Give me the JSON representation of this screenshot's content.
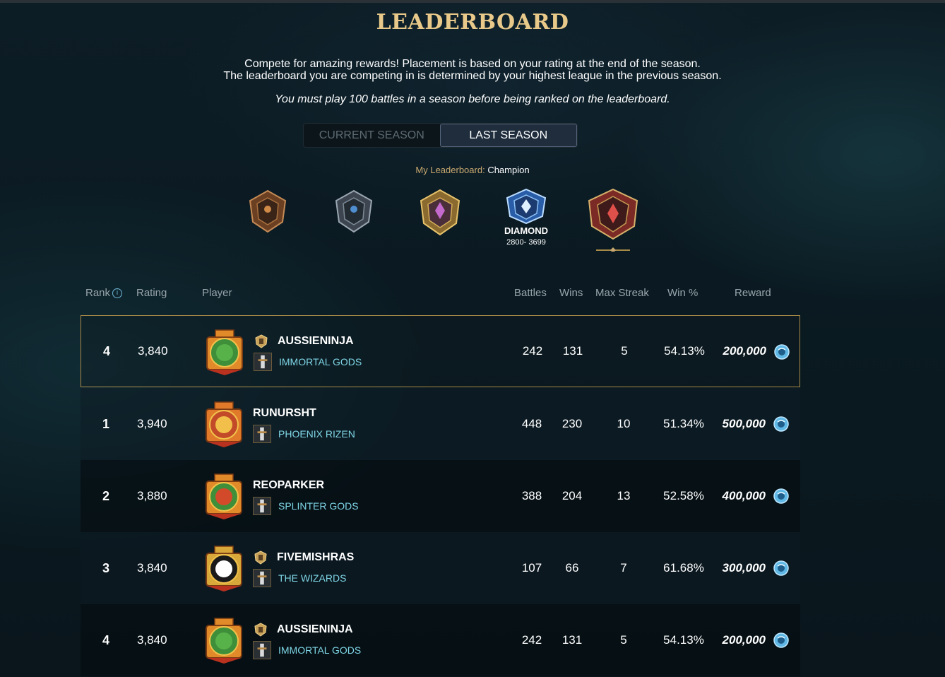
{
  "header": {
    "title": "LEADERBOARD",
    "intro_line1": "Compete for amazing rewards! Placement is based on your rating at the end of the season.",
    "intro_line2": "The leaderboard you are competing in is determined by your highest league in the previous season.",
    "note": "You must play 100 battles in a season before being ranked on the leaderboard."
  },
  "tabs": {
    "current": "CURRENT SEASON",
    "last": "LAST SEASON",
    "selected": "last"
  },
  "my_leaderboard": {
    "label": "My Leaderboard:",
    "value": "Champion"
  },
  "leagues": {
    "items": [
      {
        "icon": "bronze-league-icon",
        "name": "",
        "range": ""
      },
      {
        "icon": "silver-league-icon",
        "name": "",
        "range": ""
      },
      {
        "icon": "gold-league-icon",
        "name": "",
        "range": ""
      },
      {
        "icon": "diamond-league-icon",
        "name": "DIAMOND",
        "range": "2800- 3699"
      },
      {
        "icon": "champion-league-icon",
        "name": "",
        "range": ""
      }
    ],
    "selected_index": 4
  },
  "columns": {
    "rank": "Rank",
    "rating": "Rating",
    "player": "Player",
    "battles": "Battles",
    "wins": "Wins",
    "max_streak": "Max Streak",
    "win_pct": "Win %",
    "reward": "Reward"
  },
  "rows": [
    {
      "rank": "4",
      "rating": "3,840",
      "player": "AUSSIENINJA",
      "guild": "IMMORTAL GODS",
      "battles": "242",
      "wins": "131",
      "max_streak": "5",
      "win_pct": "54.13%",
      "reward": "200,000",
      "avatar": "orc-avatar-icon",
      "title_icon": "shield-title-icon",
      "guild_icon": "sword-guild-icon",
      "highlighted": true
    },
    {
      "rank": "1",
      "rating": "3,940",
      "player": "RUNURSHT",
      "guild": "PHOENIX RIZEN",
      "battles": "448",
      "wins": "230",
      "max_streak": "10",
      "win_pct": "51.34%",
      "reward": "500,000",
      "avatar": "fire-skull-avatar-icon",
      "title_icon": "",
      "guild_icon": "phoenix-guild-icon",
      "highlighted": false
    },
    {
      "rank": "2",
      "rating": "3,880",
      "player": "REOPARKER",
      "guild": "SPLINTER GODS",
      "battles": "388",
      "wins": "204",
      "max_streak": "13",
      "win_pct": "52.58%",
      "reward": "400,000",
      "avatar": "jester-avatar-icon",
      "title_icon": "",
      "guild_icon": "skull-guild-icon",
      "highlighted": false
    },
    {
      "rank": "3",
      "rating": "3,840",
      "player": "FIVEMISHRAS",
      "guild": "THE WIZARDS",
      "battles": "107",
      "wins": "66",
      "max_streak": "7",
      "win_pct": "61.68%",
      "reward": "300,000",
      "avatar": "monster-mouth-avatar-icon",
      "title_icon": "tower-title-icon",
      "guild_icon": "book-guild-icon",
      "highlighted": false
    },
    {
      "rank": "4",
      "rating": "3,840",
      "player": "AUSSIENINJA",
      "guild": "IMMORTAL GODS",
      "battles": "242",
      "wins": "131",
      "max_streak": "5",
      "win_pct": "54.13%",
      "reward": "200,000",
      "avatar": "orc-avatar-icon",
      "title_icon": "shield-title-icon",
      "guild_icon": "sword-guild-icon",
      "highlighted": false
    }
  ],
  "colors": {
    "accent_gold": "#e8c98a",
    "guild_cyan": "#7fd6e6",
    "highlight_border": "#a88a48"
  }
}
